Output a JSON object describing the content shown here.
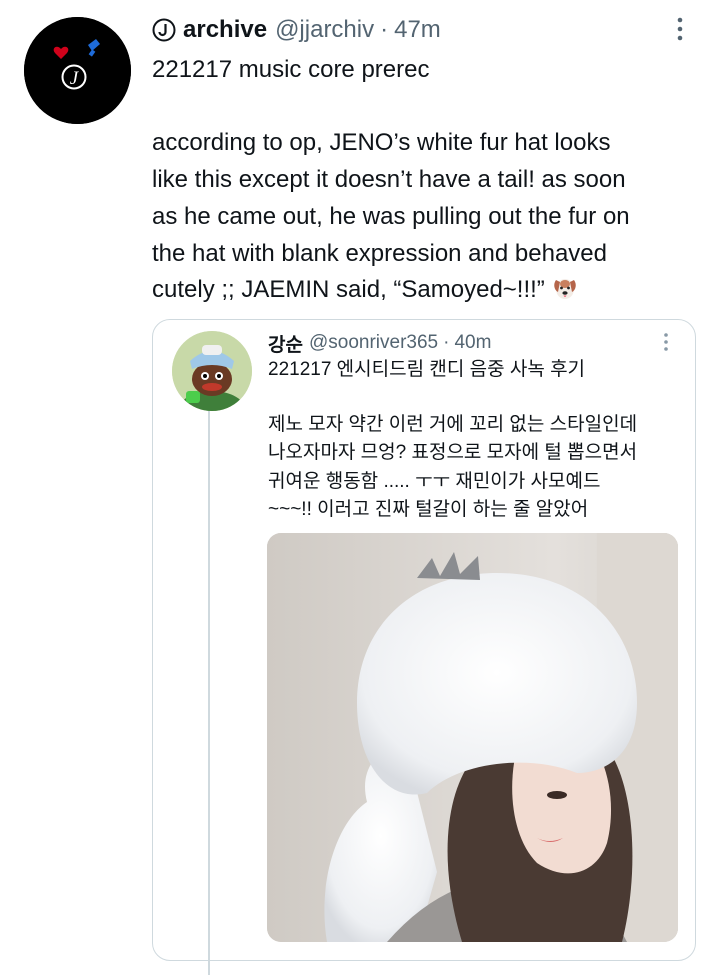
{
  "tweet": {
    "display_name": "archive",
    "handle": "@jjarchiv",
    "separator": "·",
    "time": "47m",
    "lines": [
      "221217 music core prerec",
      "",
      "according to op, JENO’s white fur hat looks",
      "like this except it doesn’t have a tail! as soon",
      "as he came out, he was pulling out the fur on",
      "the hat with blank expression and behaved",
      "cutely ;; JAEMIN said, “Samoyed~!!!”"
    ],
    "emoji_icon": "dog-face-icon"
  },
  "quote": {
    "display_name": "강순",
    "handle": "@soonriver365",
    "separator": "·",
    "time": "40m",
    "lines": [
      "221217 엔시티드림 캔디 음중 사녹 후기",
      "",
      "제노 모자 약간 이런 거에 꼬리 없는 스타일인데",
      "나오자마자 므엉? 표정으로 모자에 털 뽑으면서",
      "귀여운 행동함 ..... ㅜㅜ 재민이가 사모예드",
      "~~~!! 이러고 진짜 털갈이 하는 줄 알았어"
    ]
  },
  "colors": {
    "text": "#0f1419",
    "secondary": "#536471",
    "border": "#cfd9de"
  }
}
